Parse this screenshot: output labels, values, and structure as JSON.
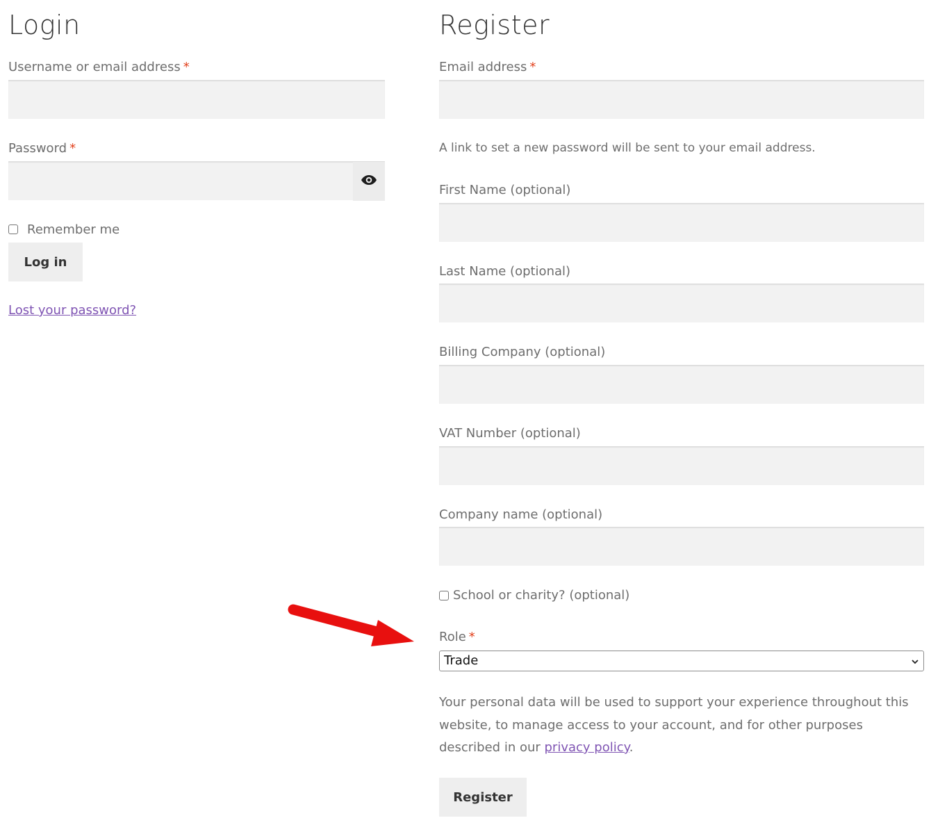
{
  "login": {
    "title": "Login",
    "username_label": "Username or email address",
    "password_label": "Password",
    "required_mark": "*",
    "remember_label": "Remember me",
    "login_button": "Log in",
    "lost_password_link": "Lost your password?",
    "show_password_icon": "eye-icon"
  },
  "register": {
    "title": "Register",
    "email_label": "Email address",
    "password_notice": "A link to set a new password will be sent to your email address.",
    "first_name_label": "First Name (optional)",
    "last_name_label": "Last Name (optional)",
    "billing_company_label": "Billing Company (optional)",
    "vat_label": "VAT Number (optional)",
    "company_name_label": "Company name (optional)",
    "school_charity_label": "School or charity? (optional)",
    "role_label": "Role",
    "role_value": "Trade",
    "privacy_text_before": "Your personal data will be used to support your experience throughout this website, to manage access to your account, and for other purposes described in our ",
    "privacy_link": "privacy policy",
    "privacy_text_after": ".",
    "register_button": "Register"
  },
  "colors": {
    "accent_link": "#7f54b3",
    "required": "#e2401c",
    "input_bg": "#f2f2f2",
    "button_bg": "#eeeeee",
    "annotation_arrow": "#e8100f"
  }
}
